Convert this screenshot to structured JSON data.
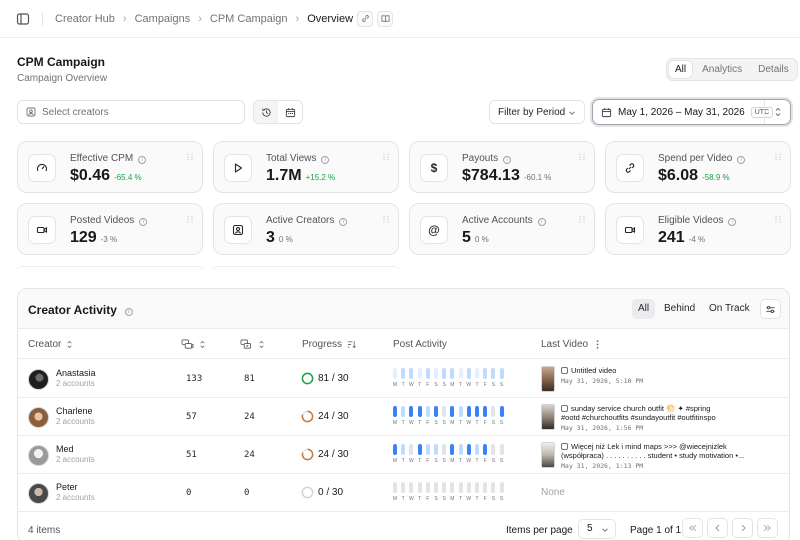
{
  "breadcrumb": [
    "Creator Hub",
    "Campaigns",
    "CPM Campaign",
    "Overview"
  ],
  "page": {
    "title": "CPM Campaign",
    "subtitle": "Campaign Overview"
  },
  "view_tabs": [
    "All",
    "Analytics",
    "Details"
  ],
  "filters": {
    "creators_placeholder": "Select creators",
    "period_label": "Filter by Period",
    "date_range": "May 1, 2026 – May 31, 2026",
    "timezone": "UTC"
  },
  "metrics": [
    {
      "label": "Effective CPM",
      "value": "$0.46",
      "change": "-65.4 %",
      "icon": "gauge-icon"
    },
    {
      "label": "Total Views",
      "value": "1.7M",
      "change": "+15.2 %",
      "icon": "play-icon"
    },
    {
      "label": "Payouts",
      "value": "$784.13",
      "change": "-60.1 %",
      "icon": "dollar-icon"
    },
    {
      "label": "Spend per Video",
      "value": "$6.08",
      "change": "-58.9 %",
      "icon": "link-icon"
    },
    {
      "label": "Posted Videos",
      "value": "129",
      "change": "-3 %",
      "icon": "video-icon"
    },
    {
      "label": "Active Creators",
      "value": "3",
      "change": "0 %",
      "icon": "user-badge-icon"
    },
    {
      "label": "Active Accounts",
      "value": "5",
      "change": "0 %",
      "icon": "at-sign-icon"
    },
    {
      "label": "Eligible Videos",
      "value": "241",
      "change": "-4 %",
      "icon": "video-icon"
    }
  ],
  "activity": {
    "title": "Creator Activity",
    "status_filters": [
      "All",
      "Behind",
      "On Track"
    ],
    "columns": {
      "creator": "Creator",
      "progress": "Progress",
      "post_activity": "Post Activity",
      "last_video": "Last Video"
    },
    "day_letters": [
      "M",
      "T",
      "W",
      "T",
      "F",
      "S",
      "S",
      "M",
      "T",
      "W",
      "T",
      "F",
      "S",
      "S"
    ],
    "rows": [
      {
        "name": "Anastasia",
        "accounts": "2 accounts",
        "col1": "133",
        "col2": "81",
        "progress": "81 / 30",
        "progress_pct": 100,
        "activity": [
          "hatch",
          "partial",
          "partial",
          "hatch",
          "partial",
          "hatch",
          "partial",
          "partial",
          "hatch",
          "partial",
          "hatch",
          "partial",
          "partial",
          "partial"
        ],
        "last_video": {
          "title": "Untitled video",
          "title2": "",
          "date": "May 31, 2026, 5:10 PM"
        }
      },
      {
        "name": "Charlene",
        "accounts": "2 accounts",
        "col1": "57",
        "col2": "24",
        "progress": "24 / 30",
        "progress_pct": 80,
        "activity": [
          "full",
          "partial",
          "full",
          "full",
          "partial",
          "full",
          "none",
          "full",
          "partial",
          "full",
          "full",
          "full",
          "none",
          "full"
        ],
        "last_video": {
          "title": "sunday service church outfit 🌕 ✦ #spring",
          "title2": "#ootd #churchoutfits #sundayoutfit #outfitinspo",
          "date": "May 31, 2026, 1:56 PM"
        }
      },
      {
        "name": "Med",
        "accounts": "2 accounts",
        "col1": "51",
        "col2": "24",
        "progress": "24 / 30",
        "progress_pct": 80,
        "activity": [
          "full",
          "partial",
          "none",
          "full",
          "partial",
          "partial",
          "none",
          "full",
          "partial",
          "full",
          "partial",
          "full",
          "none",
          "none"
        ],
        "last_video": {
          "title": "Więcej niż Lek i mind maps >>> @wiecejnizlek",
          "title2": "(współpraca) . . . . . . . . . . student • study motivation •...",
          "date": "May 31, 2026, 1:13 PM"
        }
      },
      {
        "name": "Peter",
        "accounts": "2 accounts",
        "col1": "0",
        "col2": "0",
        "progress": "0 / 30",
        "progress_pct": 0,
        "activity": [
          "none",
          "none",
          "none",
          "none",
          "none",
          "none",
          "none",
          "none",
          "none",
          "none",
          "none",
          "none",
          "none",
          "none"
        ],
        "last_video": null,
        "none_label": "None"
      }
    ]
  },
  "pagination": {
    "items": "4 items",
    "per_page_label": "Items per page",
    "per_page": "5",
    "page_info": "Page 1 of 1"
  },
  "colors": {
    "accent": "#3b82f6",
    "positive": "#16a34a",
    "progress_full": "#16a34a",
    "progress_partial": "#c2783e"
  }
}
